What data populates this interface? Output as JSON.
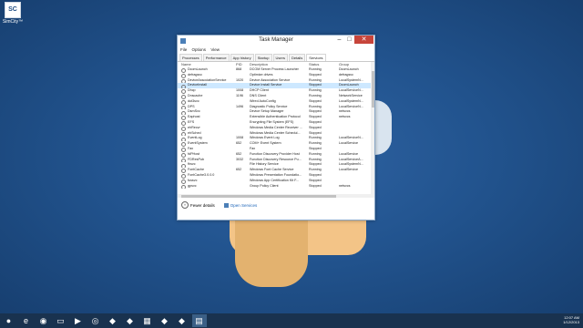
{
  "desktop": {
    "icon_text": "SC",
    "icon_label": "SimCity™"
  },
  "window": {
    "title": "Task Manager",
    "menu": [
      "File",
      "Options",
      "View"
    ],
    "tabs": [
      "Processes",
      "Performance",
      "App history",
      "Startup",
      "Users",
      "Details",
      "Services"
    ],
    "active_tab": "Services",
    "columns": [
      "Name",
      "PID",
      "Description",
      "Status",
      "Group"
    ],
    "rows": [
      [
        "DcomLaunch",
        "868",
        "DCOM Server Process Launcher",
        "Running",
        "DcomLaunch"
      ],
      [
        "defragsvc",
        "",
        "Optimize drives",
        "Stopped",
        "defragsvc"
      ],
      [
        "DeviceAssociationService",
        "1020",
        "Device Association Service",
        "Running",
        "LocalSystemN..."
      ],
      [
        "DeviceInstall",
        "",
        "Device Install Service",
        "Stopped",
        "DcomLaunch"
      ],
      [
        "Dhcp",
        "1008",
        "DHCP Client",
        "Running",
        "LocalServiceN..."
      ],
      [
        "Dnscache",
        "1196",
        "DNS Client",
        "Running",
        "NetworkService"
      ],
      [
        "dot3svc",
        "",
        "Wired AutoConfig",
        "Stopped",
        "LocalSystemN..."
      ],
      [
        "DPS",
        "1496",
        "Diagnostic Policy Service",
        "Running",
        "LocalServiceN..."
      ],
      [
        "DsmSvc",
        "",
        "Device Setup Manager",
        "Stopped",
        "netsvcs"
      ],
      [
        "Eaphost",
        "",
        "Extensible Authentication Protocol",
        "Stopped",
        "netsvcs"
      ],
      [
        "EFS",
        "",
        "Encrypting File System (EFS)",
        "Stopped",
        ""
      ],
      [
        "ehRecvr",
        "",
        "Windows Media Center Receiver ...",
        "Stopped",
        ""
      ],
      [
        "ehSched",
        "",
        "Windows Media Center Schedul...",
        "Stopped",
        ""
      ],
      [
        "EventLog",
        "1008",
        "Windows Event Log",
        "Running",
        "LocalServiceN..."
      ],
      [
        "EventSystem",
        "652",
        "COM+ Event System",
        "Running",
        "LocalService"
      ],
      [
        "Fax",
        "",
        "Fax",
        "Stopped",
        ""
      ],
      [
        "fdPHost",
        "652",
        "Function Discovery Provider Host",
        "Running",
        "LocalService"
      ],
      [
        "FDResPub",
        "3032",
        "Function Discovery Resource Pu...",
        "Running",
        "LocalServiceA..."
      ],
      [
        "fhsvc",
        "",
        "File History Service",
        "Stopped",
        "LocalSystemN..."
      ],
      [
        "FontCache",
        "652",
        "Windows Font Cache Service",
        "Running",
        "LocalService"
      ],
      [
        "FontCache3.0.0.0",
        "",
        "Windows Presentation Foundatio...",
        "Stopped",
        ""
      ],
      [
        "fussvc",
        "",
        "Windows App Certification Kit F...",
        "Stopped",
        ""
      ],
      [
        "gpsvc",
        "",
        "Group Policy Client",
        "Stopped",
        "netsvcs"
      ]
    ],
    "selected_row": 3,
    "footer": {
      "fewer_details": "Fewer details",
      "open_services": "Open Services"
    },
    "close_color": "#c7453b",
    "selection_color": "#cde8ff"
  },
  "taskbar": {
    "items": [
      "start-orb-icon",
      "ie-icon",
      "chrome-icon",
      "explorer-icon",
      "media-icon",
      "steam-icon",
      "app-icon",
      "app-icon",
      "minecraft-icon",
      "app-icon",
      "app-icon",
      "task-manager-icon"
    ],
    "clock_time": "12:07 AM",
    "clock_date": "1/12/2013"
  }
}
